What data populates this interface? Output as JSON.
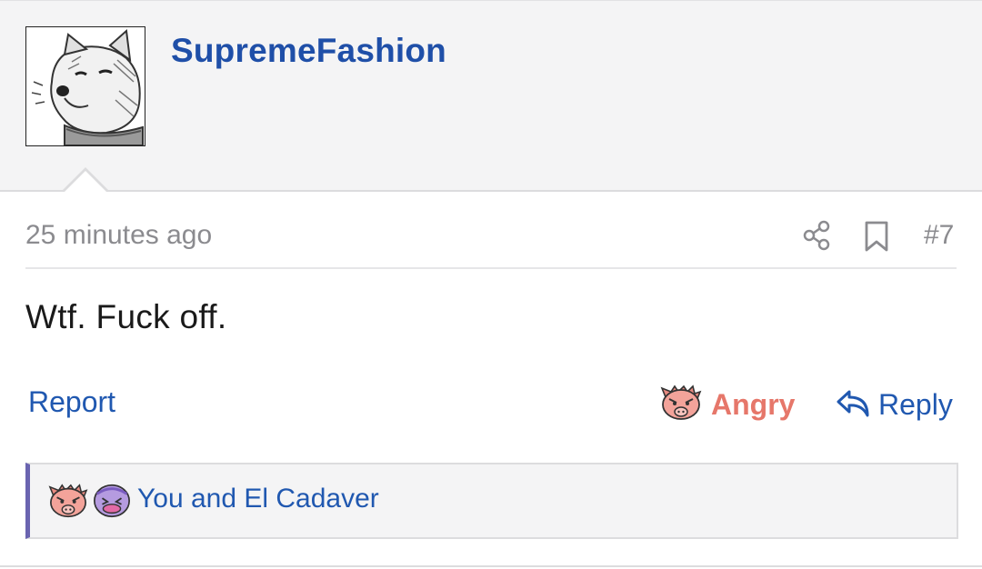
{
  "post": {
    "author": "SupremeFashion",
    "timestamp": "25 minutes ago",
    "post_number": "#7",
    "body": "Wtf. Fuck off.",
    "report_label": "Report",
    "reaction_label": "Angry",
    "reply_label": "Reply",
    "reactions_summary": "You and El Cadaver"
  },
  "icons": {
    "share": "share-icon",
    "bookmark": "bookmark-icon",
    "reply": "reply-arrow-icon",
    "angry_reaction": "angry-pig-icon",
    "purple_reaction": "purple-face-icon"
  },
  "colors": {
    "link": "#2058b0",
    "username": "#1f4fa8",
    "angry": "#e6776a",
    "accent_border": "#6a64b0",
    "header_bg": "#f4f4f5"
  }
}
